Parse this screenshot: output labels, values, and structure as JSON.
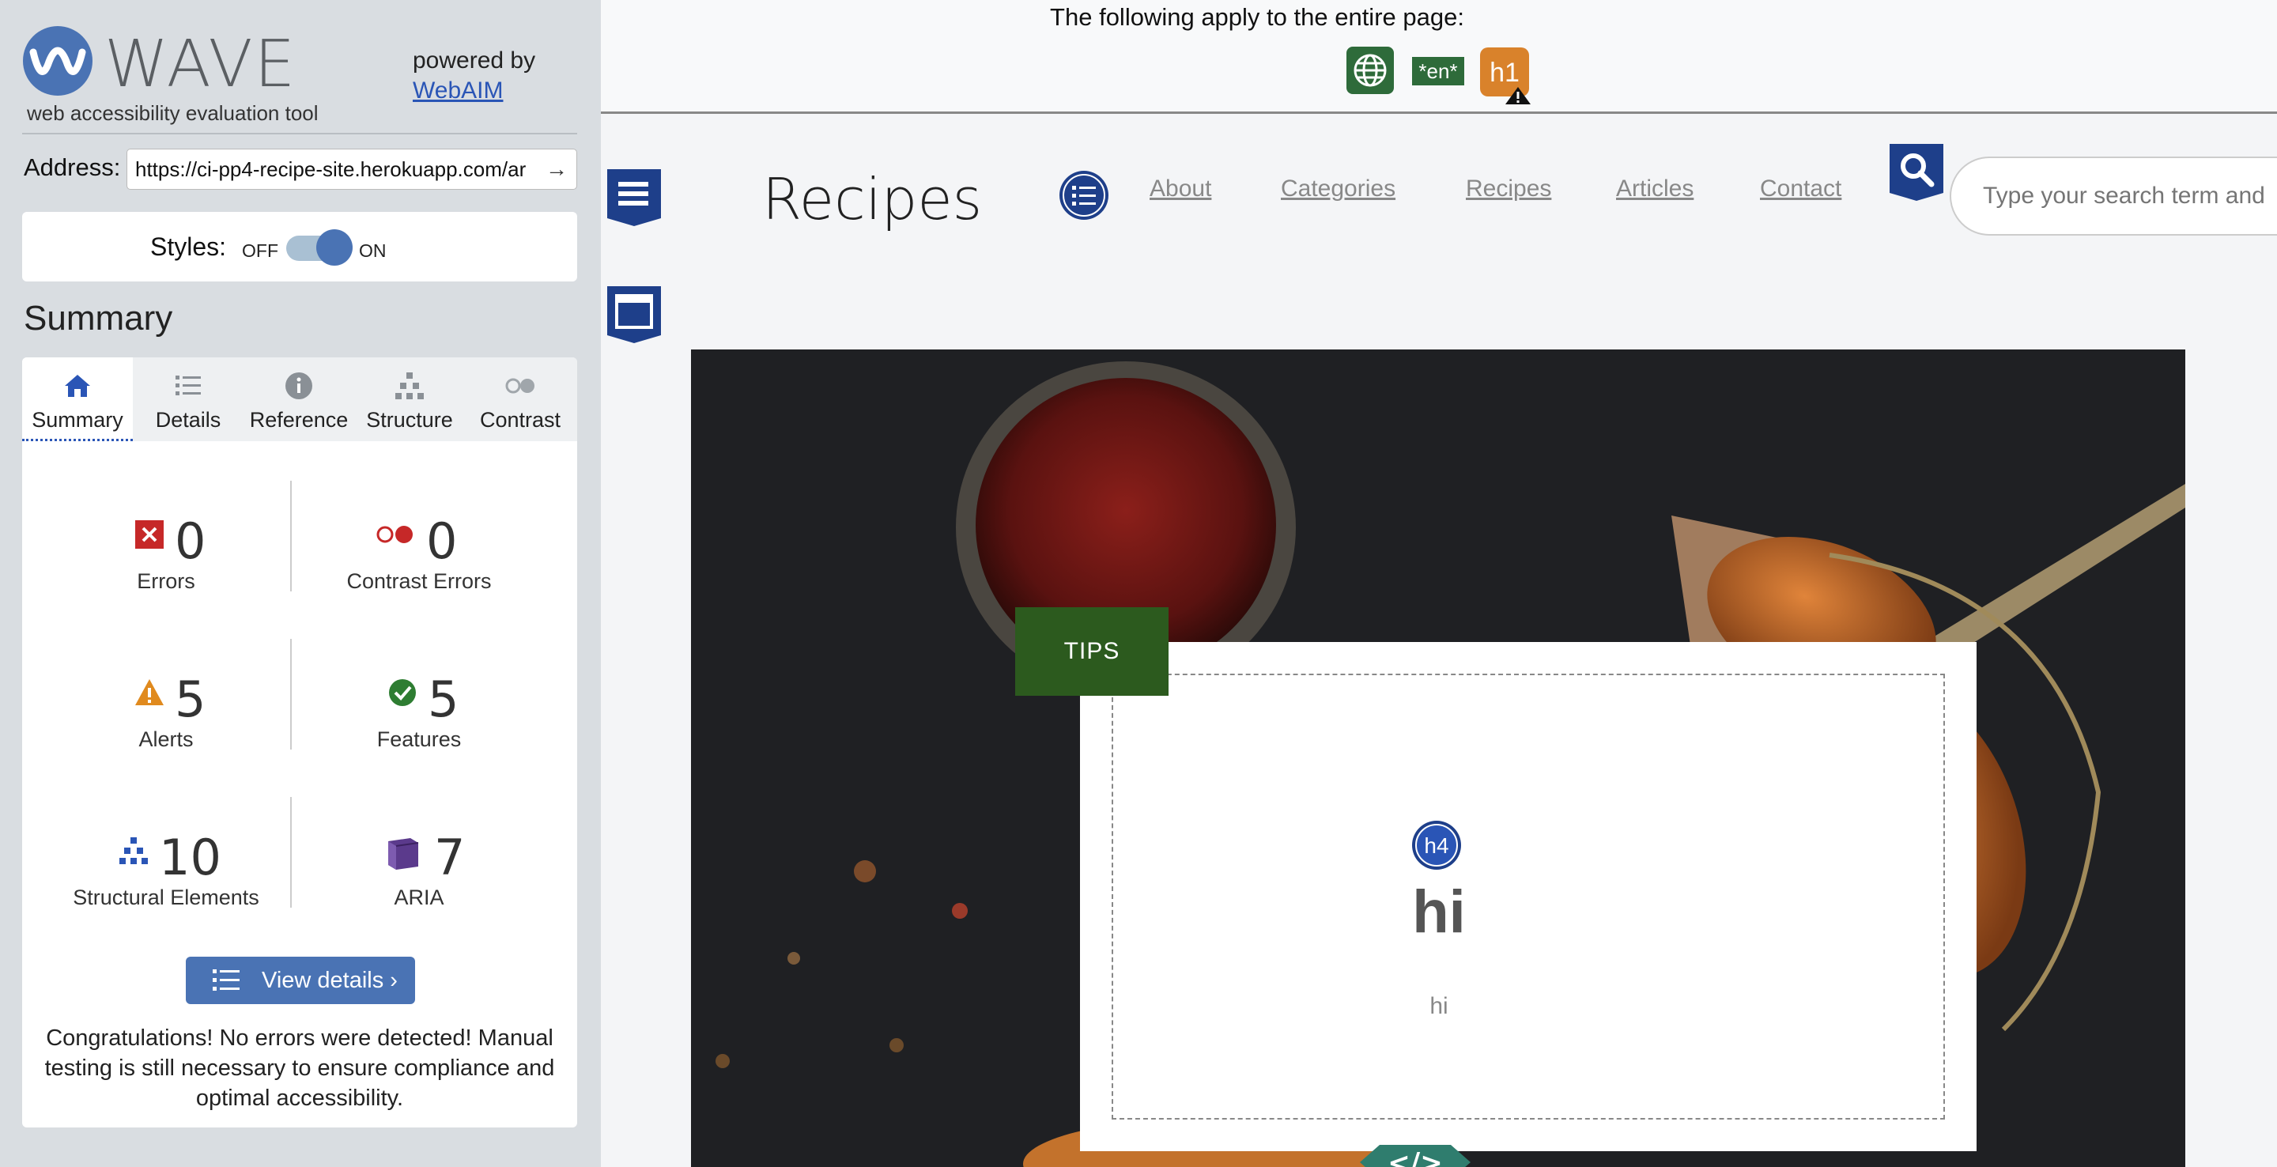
{
  "sidebar": {
    "logo_word": "WAVE",
    "tagline": "web accessibility evaluation tool",
    "powered_by": "powered by",
    "powered_link": "WebAIM",
    "address_label": "Address:",
    "address_value": "https://ci-pp4-recipe-site.herokuapp.com/ar",
    "styles_label": "Styles:",
    "styles_off": "OFF",
    "styles_on": "ON",
    "summary_heading": "Summary",
    "tabs": [
      {
        "label": "Summary",
        "icon": "home-icon"
      },
      {
        "label": "Details",
        "icon": "list-icon"
      },
      {
        "label": "Reference",
        "icon": "info-icon"
      },
      {
        "label": "Structure",
        "icon": "hierarchy-icon"
      },
      {
        "label": "Contrast",
        "icon": "contrast-icon"
      }
    ],
    "stats": {
      "errors": {
        "count": "0",
        "label": "Errors"
      },
      "contrast_errors": {
        "count": "0",
        "label": "Contrast Errors"
      },
      "alerts": {
        "count": "5",
        "label": "Alerts"
      },
      "features": {
        "count": "5",
        "label": "Features"
      },
      "structural": {
        "count": "10",
        "label": "Structural Elements"
      },
      "aria": {
        "count": "7",
        "label": "ARIA"
      }
    },
    "details_button": "View details ›",
    "congrats": "Congratulations! No errors were detected! Manual testing is still necessary to ensure compliance and optimal accessibility."
  },
  "page": {
    "banner_text": "The following apply to the entire page:",
    "lang_badge": "*en*",
    "h1_badge": "h1",
    "brand": "Recipes",
    "nav": [
      "About",
      "Categories",
      "Recipes",
      "Articles",
      "Contact"
    ],
    "search_placeholder": "Type your search term and",
    "tips_tag": "TIPS",
    "h4_badge": "h4",
    "card_title": "hi",
    "card_text": "hi",
    "code_badge": "</>"
  },
  "colors": {
    "wave_blue": "#4a73b4",
    "error_red": "#c62828",
    "alert_orange": "#e08a1e",
    "feature_green": "#2e7d32",
    "aria_purple": "#5b3a8c",
    "tips_green": "#2c5a1e"
  }
}
